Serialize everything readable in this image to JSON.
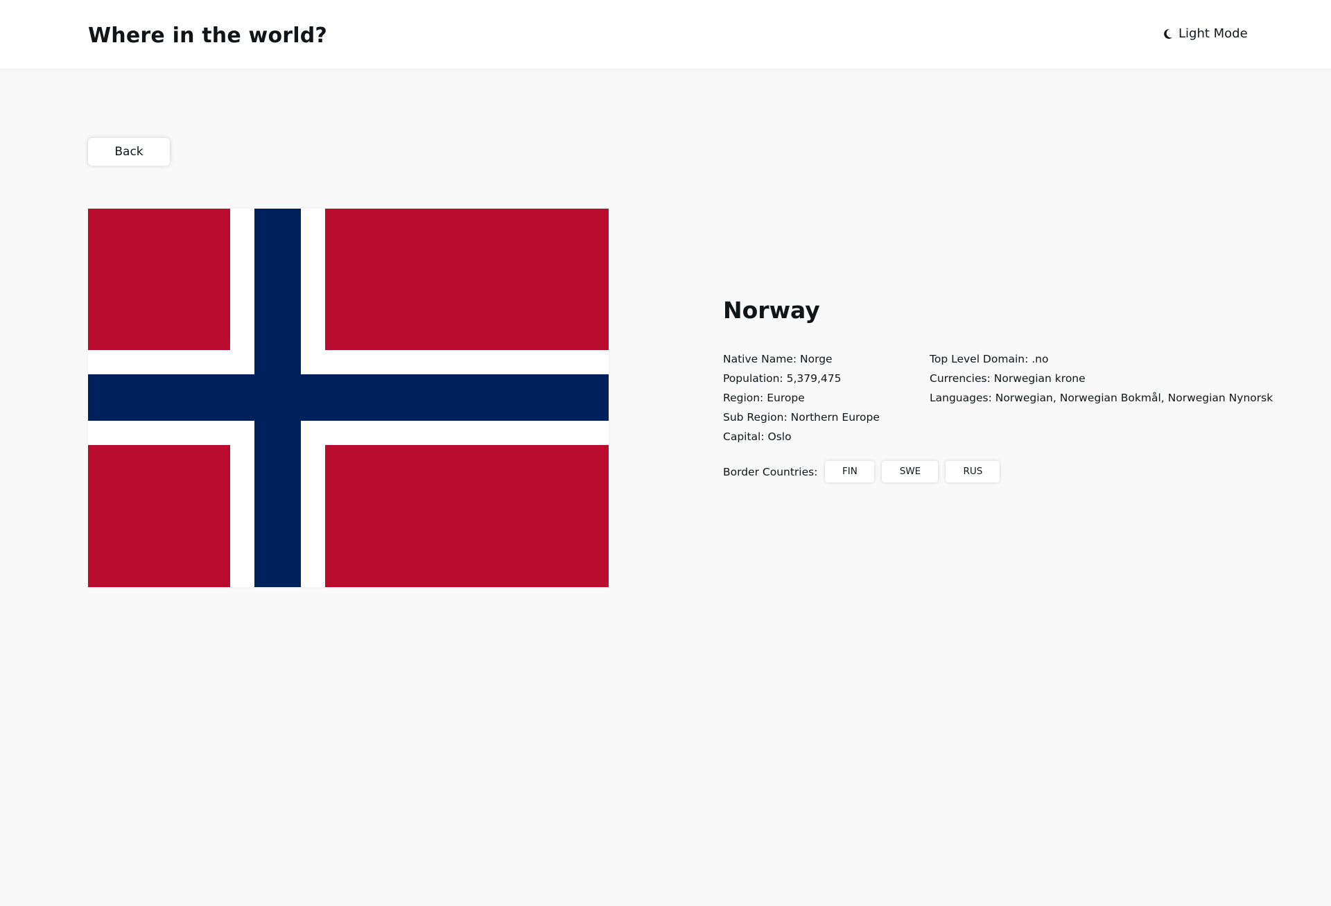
{
  "header": {
    "title": "Where in the world?",
    "theme_label": "Light Mode",
    "theme_icon": "moon-icon"
  },
  "back_button": {
    "label": "Back"
  },
  "flag": {
    "icon": "norway-flag",
    "colors": {
      "red": "#ba0c2f",
      "white": "#ffffff",
      "blue": "#00205b"
    }
  },
  "country": {
    "name": "Norway",
    "left": [
      {
        "label": "Native Name:",
        "value": "Norge"
      },
      {
        "label": "Population:",
        "value": "5,379,475"
      },
      {
        "label": "Region:",
        "value": "Europe"
      },
      {
        "label": "Sub Region:",
        "value": "Northern Europe"
      },
      {
        "label": "Capital:",
        "value": "Oslo"
      }
    ],
    "right": [
      {
        "label": "Top Level Domain:",
        "value": ".no"
      },
      {
        "label": "Currencies:",
        "value": "Norwegian krone"
      },
      {
        "label": "Languages:",
        "value": "Norwegian, Norwegian Bokmål, Norwegian Nynorsk"
      }
    ],
    "border_label": "Border Countries:",
    "borders": [
      "FIN",
      "SWE",
      "RUS"
    ]
  },
  "colors": {
    "background": "#f9f9f9",
    "surface": "#ffffff",
    "text": "#111517"
  }
}
